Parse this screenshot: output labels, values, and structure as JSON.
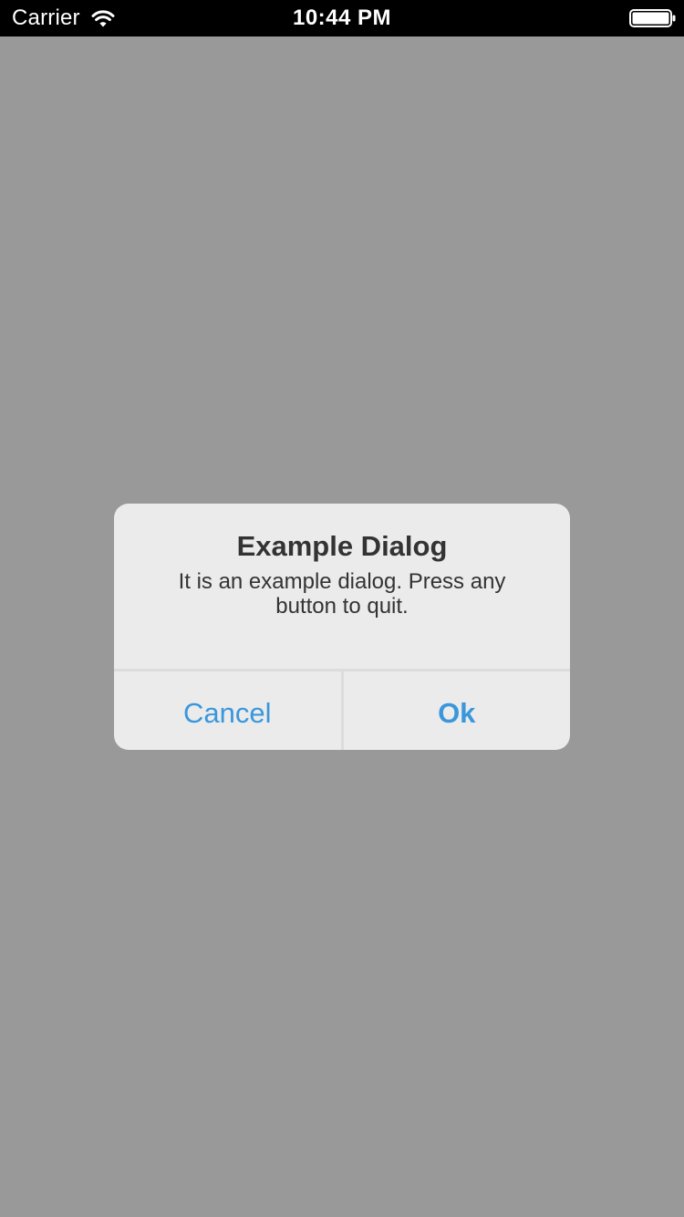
{
  "status_bar": {
    "carrier": "Carrier",
    "time": "10:44 PM",
    "wifi_icon": "wifi-icon",
    "battery_icon": "battery-icon"
  },
  "dialog": {
    "title": "Example Dialog",
    "message": "It is an example dialog. Press any button to quit.",
    "cancel_label": "Cancel",
    "ok_label": "Ok"
  },
  "colors": {
    "backdrop": "#999999",
    "dialog_background": "#ebebeb",
    "button_text": "#3a97dc",
    "status_bar": "#000000"
  }
}
